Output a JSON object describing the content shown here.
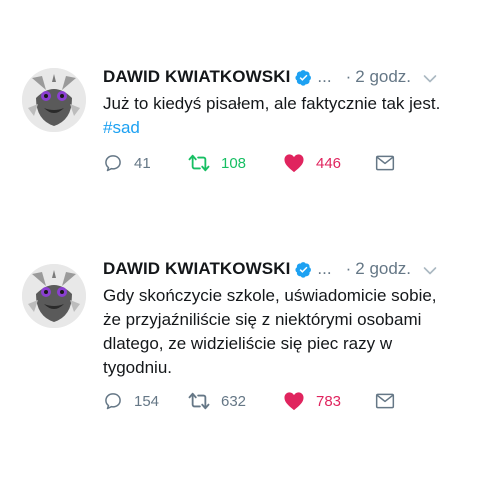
{
  "colors": {
    "text": "#14171a",
    "muted": "#657786",
    "link": "#1da1f2",
    "retweet_active": "#17bf63",
    "like": "#e0245e",
    "verified": "#1da1f2"
  },
  "tweets": [
    {
      "author": "DAWID KWIATKOWSKI",
      "handle": "...",
      "separator": "·",
      "time": "2 godz.",
      "text": "Już to kiedyś pisałem, ale faktycznie tak jest.",
      "hashtag": "#sad",
      "replies": "41",
      "retweets": "108",
      "retweeted": true,
      "likes": "446",
      "liked": true,
      "icons": [
        "reply-icon",
        "retweet-icon",
        "heart-icon",
        "message-icon",
        "chevron-down-icon",
        "verified-badge-icon"
      ]
    },
    {
      "author": "DAWID KWIATKOWSKI",
      "handle": "...",
      "separator": "·",
      "time": "2 godz.",
      "text": "Gdy skończycie szkole, uświadomicie sobie, że przyjaźniliście się z niektórymi osobami dlatego, ze widzieliście się piec razy w tygodniu.",
      "replies": "154",
      "retweets": "632",
      "retweeted": false,
      "likes": "783",
      "liked": true,
      "icons": [
        "reply-icon",
        "retweet-icon",
        "heart-icon",
        "message-icon",
        "chevron-down-icon",
        "verified-badge-icon"
      ]
    }
  ]
}
